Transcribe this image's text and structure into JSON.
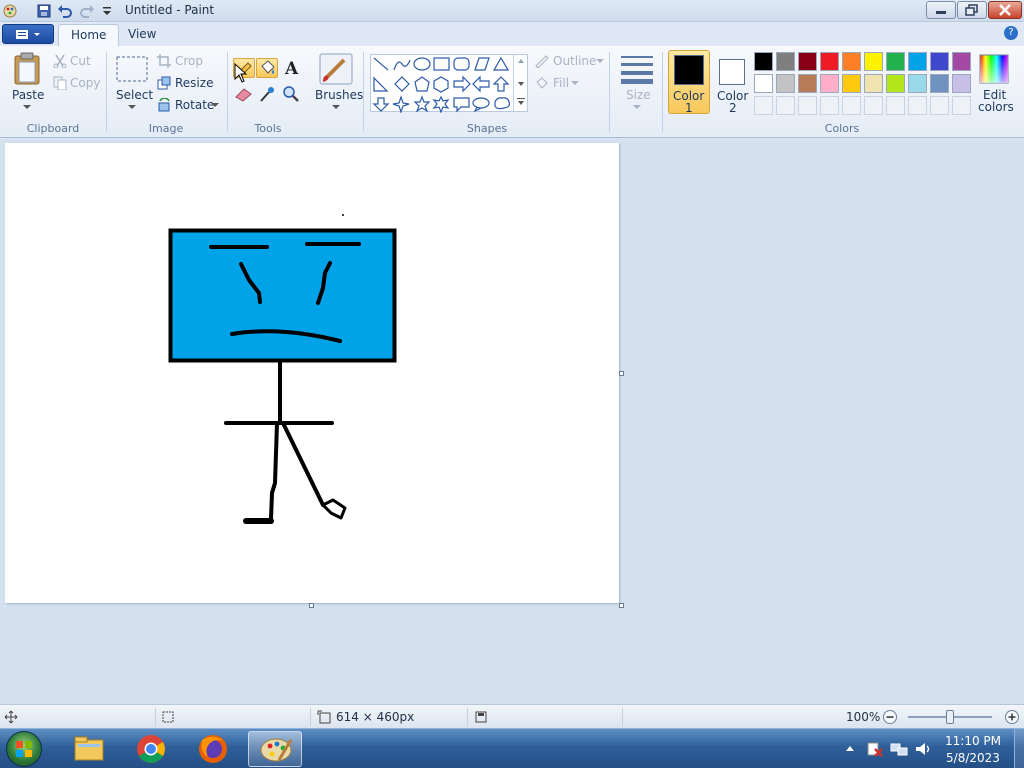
{
  "window": {
    "title": "Untitled - Paint"
  },
  "tabs": [
    {
      "label": "Home",
      "active": true
    },
    {
      "label": "View",
      "active": false
    }
  ],
  "ribbon": {
    "clipboard": {
      "group": "Clipboard",
      "paste": "Paste",
      "cut": "Cut",
      "copy": "Copy"
    },
    "image": {
      "group": "Image",
      "select": "Select",
      "crop": "Crop",
      "resize": "Resize",
      "rotate": "Rotate"
    },
    "tools": {
      "group": "Tools",
      "text_tool": "A"
    },
    "brushes": {
      "label": "Brushes"
    },
    "shapes": {
      "group": "Shapes",
      "outline": "Outline",
      "fill": "Fill"
    },
    "size": {
      "label": "Size"
    },
    "colors": {
      "group": "Colors",
      "color1_label": "Color",
      "color1_num": "1",
      "color2_label": "Color",
      "color2_num": "2",
      "edit_label": "Edit",
      "edit_label2": "colors",
      "color1": "#000000",
      "color2": "#ffffff",
      "palette_row1": [
        "#000000",
        "#7f7f7f",
        "#880015",
        "#ed1c24",
        "#ff7f27",
        "#fff200",
        "#22b14c",
        "#00a2e8",
        "#3f48cc",
        "#a349a4"
      ],
      "palette_row2": [
        "#ffffff",
        "#c3c3c3",
        "#b97a57",
        "#ffaec9",
        "#ffc90e",
        "#efe4b0",
        "#b5e61d",
        "#99d9ea",
        "#7092be",
        "#c8bfe7"
      ]
    }
  },
  "canvas": {
    "face_color": "#00a2e8",
    "stroke_color": "#000000"
  },
  "status": {
    "dimensions": "614 × 460px",
    "zoom": "100%"
  },
  "taskbar": {
    "time": "11:10 PM",
    "date": "5/8/2023"
  }
}
